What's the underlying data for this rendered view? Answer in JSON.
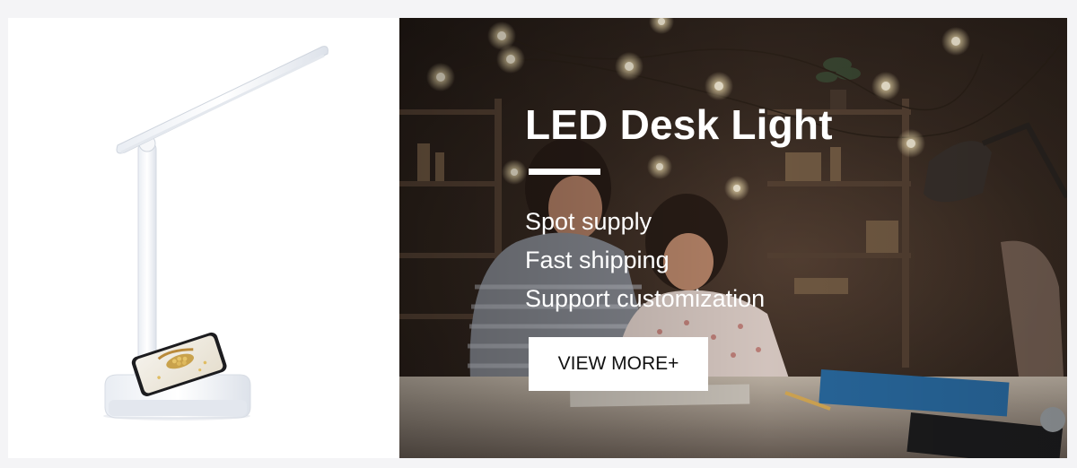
{
  "banner": {
    "title": "LED Desk Light",
    "features": [
      "Spot supply",
      "Fast shipping",
      "Support customization"
    ],
    "cta_label": "VIEW MORE+"
  },
  "colors": {
    "page_background": "#f4f4f6",
    "text": "#ffffff",
    "button_background": "#ffffff",
    "button_text": "#111111"
  }
}
